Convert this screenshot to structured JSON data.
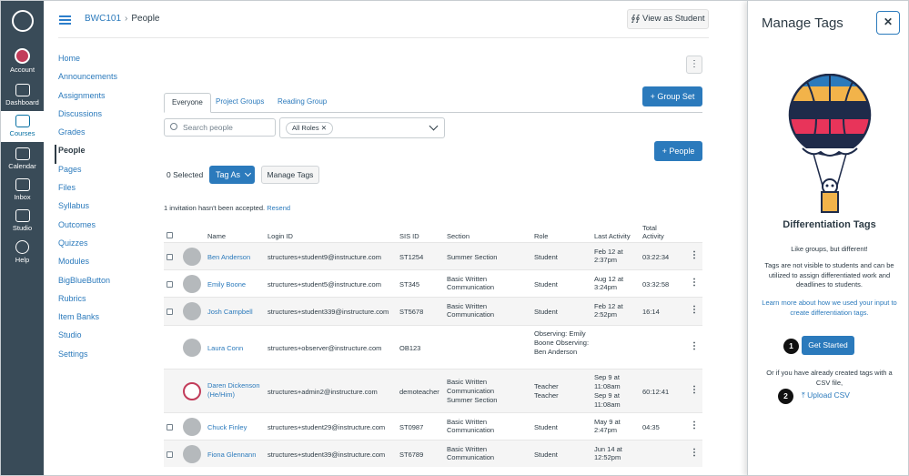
{
  "global_nav": {
    "items": [
      {
        "label": "Account",
        "icon": "account-avatar-icon"
      },
      {
        "label": "Dashboard",
        "icon": "dashboard-icon"
      },
      {
        "label": "Courses",
        "icon": "courses-icon"
      },
      {
        "label": "Calendar",
        "icon": "calendar-icon"
      },
      {
        "label": "Inbox",
        "icon": "inbox-icon"
      },
      {
        "label": "Studio",
        "icon": "studio-icon"
      },
      {
        "label": "Help",
        "icon": "help-icon"
      }
    ],
    "active": "Courses"
  },
  "header": {
    "course": "BWC101",
    "sep": "›",
    "page": "People",
    "view_as_student": "View as Student"
  },
  "course_nav": [
    "Home",
    "Announcements",
    "Assignments",
    "Discussions",
    "Grades",
    "People",
    "Pages",
    "Files",
    "Syllabus",
    "Outcomes",
    "Quizzes",
    "Modules",
    "BigBlueButton",
    "Rubrics",
    "Item Banks",
    "Studio",
    "Settings"
  ],
  "tabs": [
    "Everyone",
    "Project Groups",
    "Reading Group"
  ],
  "buttons": {
    "group_set": "+ Group Set",
    "people": "+ People",
    "tag_as": "Tag As",
    "manage_tags": "Manage Tags",
    "kebab": "⋮"
  },
  "search": {
    "placeholder": "Search people"
  },
  "roles_filter": {
    "chip": "All Roles",
    "chip_x": "✕"
  },
  "selected": "0 Selected",
  "invitation": {
    "text": "1 invitation hasn't been accepted.",
    "link": "Resend"
  },
  "table": {
    "headers": {
      "name": "Name",
      "login": "Login ID",
      "sis": "SIS ID",
      "section": "Section",
      "role": "Role",
      "last": "Last Activity",
      "total": "Total Activity"
    },
    "rows": [
      {
        "name": "Ben Anderson",
        "login": "structures+student9@instructure.com",
        "sis": "ST1254",
        "section": "Summer Section",
        "role": "Student",
        "last": "Feb 12 at 2:37pm",
        "total": "03:22:34"
      },
      {
        "name": "Emily Boone",
        "login": "structures+student5@instructure.com",
        "sis": "ST345",
        "section": "Basic Written Communication",
        "role": "Student",
        "last": "Aug 12 at 3:24pm",
        "total": "03:32:58"
      },
      {
        "name": "Josh Campbell",
        "login": "structures+student339@instructure.com",
        "sis": "ST5678",
        "section": "Basic Written Communication",
        "role": "Student",
        "last": "Feb 12 at 2:52pm",
        "total": "16:14"
      },
      {
        "name": "Laura Conn",
        "login": "structures+observer@instructure.com",
        "sis": "OB123",
        "section": "",
        "role": "Observing: Emily Boone Observing: Ben Anderson",
        "last": "",
        "total": ""
      },
      {
        "name": "Daren Dickenson (He/Him)",
        "login": "structures+admin2@instructure.com",
        "sis": "demoteacher",
        "section": "Basic Written Communication Summer Section",
        "role": "Teacher Teacher",
        "last": "Sep 9 at 11:08am Sep 9 at 11:08am",
        "total": "60:12:41"
      },
      {
        "name": "Chuck Finley",
        "login": "structures+student29@instructure.com",
        "sis": "ST0987",
        "section": "Basic Written Communication",
        "role": "Student",
        "last": "May 9 at 2:47pm",
        "total": "04:35"
      },
      {
        "name": "Fiona Glennann",
        "login": "structures+student39@instructure.com",
        "sis": "ST6789",
        "section": "Basic Written Communication",
        "role": "Student",
        "last": "Jun 14 at 12:52pm",
        "total": ""
      }
    ]
  },
  "tray": {
    "title": "Manage Tags",
    "close": "✕",
    "heading": "Differentiation Tags",
    "tagline": "Like groups, but different!",
    "description": "Tags are not visible to students and can be utilized to assign differentiated work and deadlines to students.",
    "learn_more": "Learn more about how we used your input to create differentiation tags.",
    "get_started": "Get Started",
    "csv_text": "Or if you have already created tags with a CSV file,",
    "upload_csv": "Upload CSV",
    "badge1": "1",
    "badge2": "2"
  },
  "colors": {
    "nav_bg": "#394b58",
    "link": "#2b7abc",
    "badge": "#111111"
  }
}
